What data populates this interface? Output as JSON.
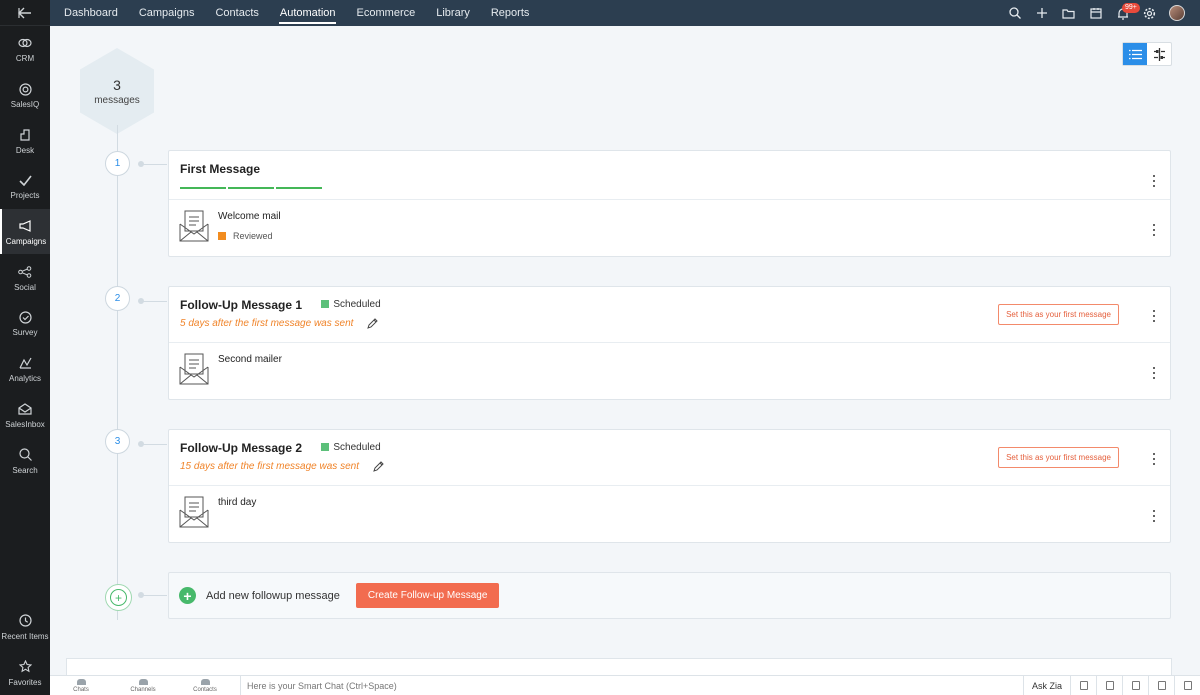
{
  "rail": {
    "items": [
      {
        "label": "CRM",
        "icon": "crm-icon"
      },
      {
        "label": "SalesIQ",
        "icon": "salesiq-icon"
      },
      {
        "label": "Desk",
        "icon": "desk-icon"
      },
      {
        "label": "Projects",
        "icon": "projects-icon"
      },
      {
        "label": "Campaigns",
        "icon": "campaigns-icon",
        "active": true
      },
      {
        "label": "Social",
        "icon": "social-icon"
      },
      {
        "label": "Survey",
        "icon": "survey-icon"
      },
      {
        "label": "Analytics",
        "icon": "analytics-icon"
      },
      {
        "label": "SalesInbox",
        "icon": "salesinbox-icon"
      },
      {
        "label": "Search",
        "icon": "search-icon"
      }
    ],
    "bottom": [
      {
        "label": "Recent Items",
        "icon": "recent-items-icon"
      },
      {
        "label": "Favorites",
        "icon": "favorites-icon"
      }
    ]
  },
  "topnav": {
    "tabs": [
      "Dashboard",
      "Campaigns",
      "Contacts",
      "Automation",
      "Ecommerce",
      "Library",
      "Reports"
    ],
    "active_tab": "Automation",
    "notification_badge": "99+"
  },
  "summary": {
    "count": "3",
    "label": "messages"
  },
  "messages": [
    {
      "step": "1",
      "title": "First Message",
      "email_name": "Welcome mail",
      "email_status": "Reviewed"
    },
    {
      "step": "2",
      "title": "Follow-Up Message 1",
      "status": "Scheduled",
      "delay": "5  days after the first message was sent",
      "set_first_label": "Set this as your first message",
      "email_name": "Second mailer"
    },
    {
      "step": "3",
      "title": "Follow-Up Message 2",
      "status": "Scheduled",
      "delay": "15  days after the first message was sent",
      "set_first_label": "Set this as your first message",
      "email_name": "third day"
    }
  ],
  "add_followup": {
    "label": "Add new followup message",
    "button": "Create Follow-up Message"
  },
  "bottombar": {
    "items": [
      "Chats",
      "Channels",
      "Contacts"
    ],
    "smart_chat_placeholder": "Here is your Smart Chat (Ctrl+Space)",
    "ask_zia": "Ask Zia"
  },
  "colors": {
    "accent_blue": "#2b8ee8",
    "progress_green": "#44b757",
    "scheduled_green": "#5cc07a",
    "reviewed_orange": "#f28c1f",
    "delay_orange": "#f0842a",
    "create_button": "#f26c4f",
    "topnav_bg": "#2c3e50",
    "rail_bg": "#1b1d1f"
  }
}
